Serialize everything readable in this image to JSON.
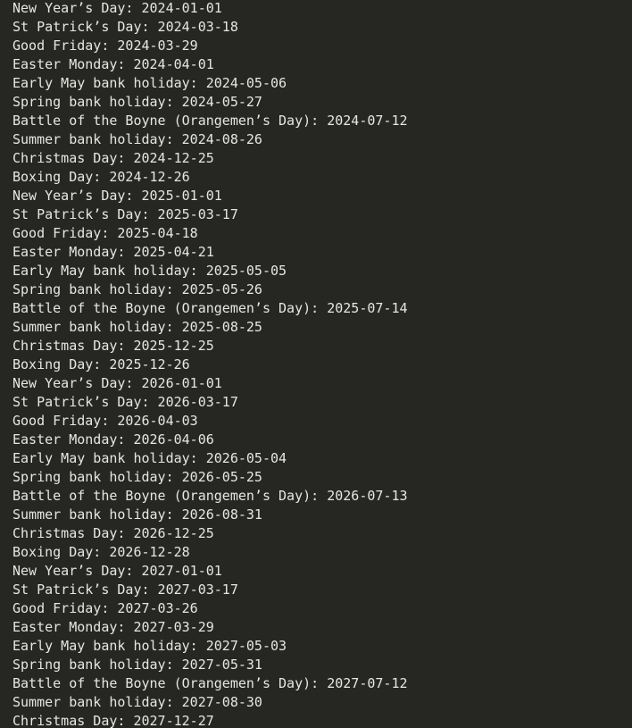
{
  "output": {
    "lines": [
      "New Year’s Day: 2024-01-01",
      "St Patrick’s Day: 2024-03-18",
      "Good Friday: 2024-03-29",
      "Easter Monday: 2024-04-01",
      "Early May bank holiday: 2024-05-06",
      "Spring bank holiday: 2024-05-27",
      "Battle of the Boyne (Orangemen’s Day): 2024-07-12",
      "Summer bank holiday: 2024-08-26",
      "Christmas Day: 2024-12-25",
      "Boxing Day: 2024-12-26",
      "New Year’s Day: 2025-01-01",
      "St Patrick’s Day: 2025-03-17",
      "Good Friday: 2025-04-18",
      "Easter Monday: 2025-04-21",
      "Early May bank holiday: 2025-05-05",
      "Spring bank holiday: 2025-05-26",
      "Battle of the Boyne (Orangemen’s Day): 2025-07-14",
      "Summer bank holiday: 2025-08-25",
      "Christmas Day: 2025-12-25",
      "Boxing Day: 2025-12-26",
      "New Year’s Day: 2026-01-01",
      "St Patrick’s Day: 2026-03-17",
      "Good Friday: 2026-04-03",
      "Easter Monday: 2026-04-06",
      "Early May bank holiday: 2026-05-04",
      "Spring bank holiday: 2026-05-25",
      "Battle of the Boyne (Orangemen’s Day): 2026-07-13",
      "Summer bank holiday: 2026-08-31",
      "Christmas Day: 2026-12-25",
      "Boxing Day: 2026-12-28",
      "New Year’s Day: 2027-01-01",
      "St Patrick’s Day: 2027-03-17",
      "Good Friday: 2027-03-26",
      "Easter Monday: 2027-03-29",
      "Early May bank holiday: 2027-05-03",
      "Spring bank holiday: 2027-05-31",
      "Battle of the Boyne (Orangemen’s Day): 2027-07-12",
      "Summer bank holiday: 2027-08-30",
      "Christmas Day: 2027-12-27"
    ]
  }
}
